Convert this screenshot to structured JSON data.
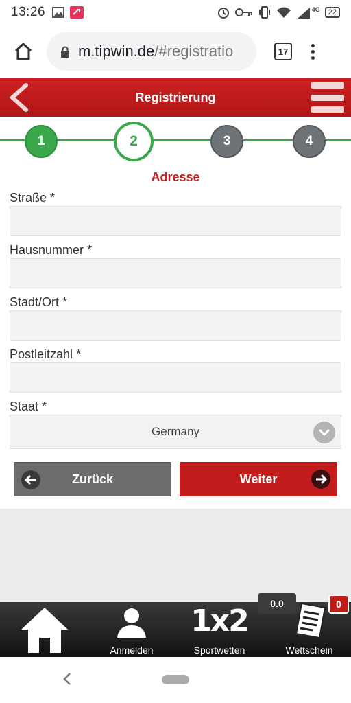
{
  "status": {
    "time": "13:26",
    "battery": "22",
    "network": "4G"
  },
  "browser": {
    "url_host": "m.tipwin.de",
    "url_path": "/#registratio",
    "tab_count": "17"
  },
  "header": {
    "title": "Registrierung"
  },
  "stepper": {
    "steps": [
      "1",
      "2",
      "3",
      "4"
    ],
    "active_step": 2
  },
  "form": {
    "section_title": "Adresse",
    "fields": [
      {
        "label": "Straße *",
        "value": ""
      },
      {
        "label": "Hausnummer *",
        "value": ""
      },
      {
        "label": "Stadt/Ort *",
        "value": ""
      },
      {
        "label": "Postleitzahl *",
        "value": ""
      }
    ],
    "country": {
      "label": "Staat *",
      "value": "Germany"
    }
  },
  "buttons": {
    "back": "Zurück",
    "next": "Weiter"
  },
  "bottom_nav": {
    "items": [
      {
        "label": "",
        "icon": "home-icon"
      },
      {
        "label": "Anmelden",
        "icon": "user-icon"
      },
      {
        "label": "Sportwetten",
        "icon": "1x2"
      },
      {
        "label": "Wettschein",
        "icon": "betslip-icon"
      }
    ],
    "balance": "0.0",
    "slip_count": "0"
  },
  "colors": {
    "brand_red": "#c21c1c",
    "step_green": "#3aa84a",
    "step_gray": "#6e7378"
  }
}
